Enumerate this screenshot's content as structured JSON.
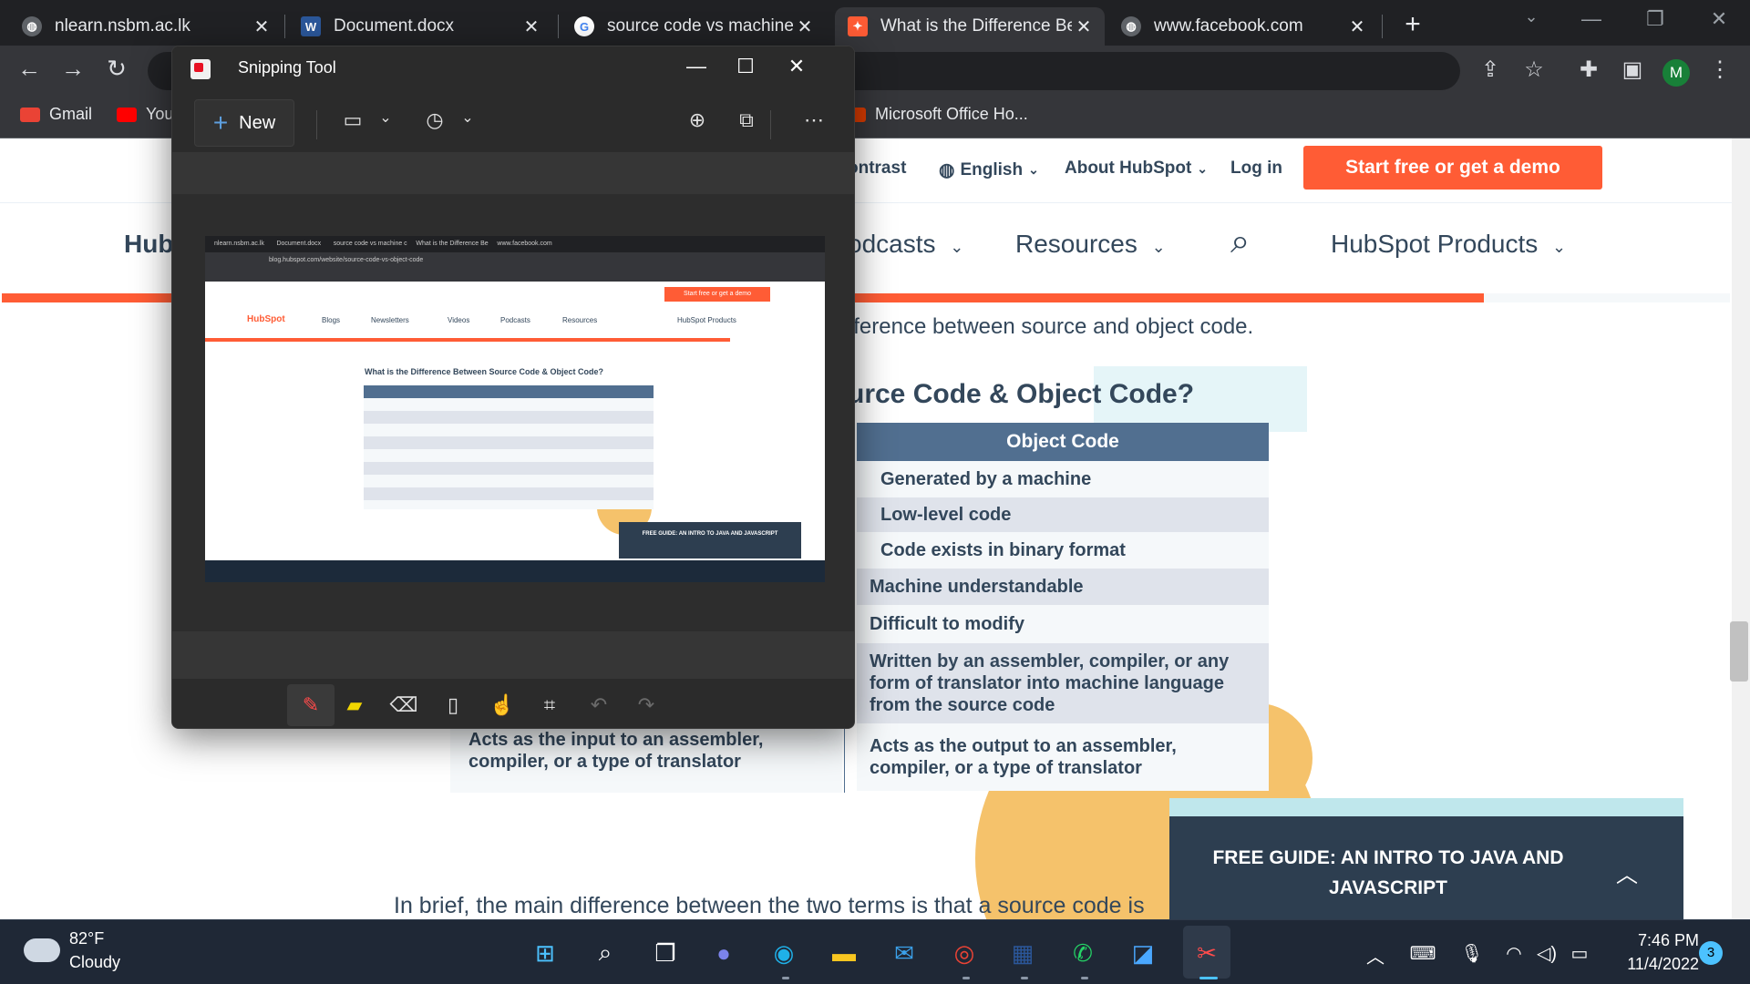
{
  "browser": {
    "tabs": [
      {
        "title": "nlearn.nsbm.ac.lk",
        "icon": "globe-icon",
        "active": false
      },
      {
        "title": "Document.docx",
        "icon": "word-icon",
        "active": false
      },
      {
        "title": "source code vs machine c",
        "icon": "google-icon",
        "active": false
      },
      {
        "title": "What is the Difference Be",
        "icon": "hubspot-icon",
        "active": true
      },
      {
        "title": "www.facebook.com",
        "icon": "globe-icon",
        "active": false
      }
    ],
    "new_tab": "+",
    "profile_initial": "M",
    "bookmarks": [
      {
        "label": "Gmail",
        "color": "#ea4335"
      },
      {
        "label": "You",
        "color": "#ff0000"
      },
      {
        "label": "Microsoft Office Ho...",
        "color": "#d83b01"
      }
    ]
  },
  "hubspot": {
    "util": {
      "contrast": "ontrast",
      "language": "English",
      "about": "About HubSpot",
      "login": "Log in",
      "cta": "Start free or get a demo"
    },
    "nav": {
      "hub": "Hub",
      "podcasts": "odcasts",
      "resources": "Resources",
      "products": "HubSpot Products"
    },
    "intro": "fference between source and object code.",
    "table_title": "urce Code & Object Code?",
    "table_header": "Object Code",
    "object_rows": [
      "Generated by a machine",
      "Low-level code",
      "Code exists in binary format",
      "Machine understandable",
      "Difficult to modify",
      "Written by an assembler, compiler, or any form of translator into machine language from the source code",
      "Acts as the output to an assembler, compiler, or a type of translator"
    ],
    "source_last_row": "Acts as the input to an assembler, compiler, or a type of translator",
    "brief": "In brief, the main difference between the two terms is that a source code is",
    "guide": "FREE GUIDE: AN INTRO TO JAVA AND JAVASCRIPT"
  },
  "snip": {
    "title": "Snipping Tool",
    "new_label": "New",
    "shot": {
      "tabs": [
        "nlearn.nsbm.ac.lk",
        "Document.docx",
        "source code vs machine c",
        "What is the Difference Be",
        "www.facebook.com"
      ],
      "url": "blog.hubspot.com/website/source-code-vs-object-code",
      "cta": "Start free or get a demo",
      "logo": "HubSpot",
      "nav": [
        "Blogs",
        "Newsletters",
        "Videos",
        "Podcasts",
        "Resources",
        "HubSpot Products"
      ],
      "table_title": "What is the Difference Between Source Code & Object Code?",
      "guide": "FREE GUIDE: AN INTRO TO JAVA AND JAVASCRIPT"
    }
  },
  "taskbar": {
    "temp": "82°F",
    "weather": "Cloudy",
    "time": "7:46 PM",
    "date": "11/4/2022",
    "notifications": "3"
  }
}
